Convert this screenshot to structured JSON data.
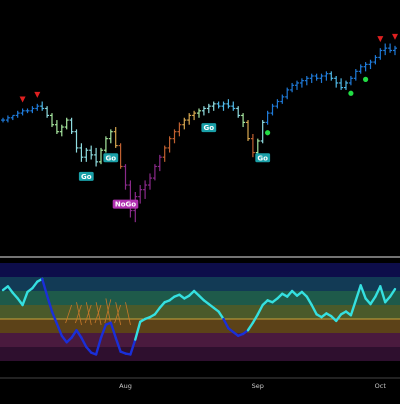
{
  "colors": {
    "background": "#000000",
    "divider": "#b8b8b8",
    "axis_text": "#c8c8c8",
    "bands": [
      "#0d0d4a",
      "#123a55",
      "#1e5a4a",
      "#4a5a2a",
      "#5c4218",
      "#4a1a3e",
      "#2e0f2e"
    ],
    "zero_line": "#c9a23c",
    "osc_up": "#35e0e0",
    "osc_down": "#1a2fd8",
    "fan": "#c7782a",
    "dot": "#22dd44",
    "triangle": "#e02020",
    "label_go_bg": "#1aa0a8",
    "label_nogo_bg": "#b030b0",
    "label_text": "#ffffff"
  },
  "chart_data": [
    {
      "type": "ohlc",
      "trend_colors": {
        "strong_go": "#1f7ad8",
        "go": "#4fb8e6",
        "weak_go": "#8fdce0",
        "neutral": "#a8e8a0",
        "weak_nogo": "#d8a850",
        "nogo": "#c06030",
        "strong_nogo": "#8a2a8a"
      },
      "ylim": [
        0,
        100
      ],
      "bars": [
        {
          "o": 56,
          "h": 57,
          "l": 55,
          "c": 56,
          "s": "strong_go"
        },
        {
          "o": 56,
          "h": 58,
          "l": 55,
          "c": 57,
          "s": "strong_go"
        },
        {
          "o": 57,
          "h": 58,
          "l": 56,
          "c": 58,
          "s": "strong_go"
        },
        {
          "o": 58,
          "h": 60,
          "l": 57,
          "c": 59,
          "s": "strong_go"
        },
        {
          "o": 59,
          "h": 61,
          "l": 58,
          "c": 60,
          "s": "strong_go"
        },
        {
          "o": 60,
          "h": 61,
          "l": 59,
          "c": 60,
          "s": "strong_go"
        },
        {
          "o": 60,
          "h": 62,
          "l": 59,
          "c": 61,
          "s": "strong_go"
        },
        {
          "o": 61,
          "h": 63,
          "l": 60,
          "c": 62,
          "s": "strong_go"
        },
        {
          "o": 62,
          "h": 64,
          "l": 60,
          "c": 61,
          "s": "go"
        },
        {
          "o": 61,
          "h": 62,
          "l": 57,
          "c": 58,
          "s": "weak_go"
        },
        {
          "o": 58,
          "h": 59,
          "l": 53,
          "c": 54,
          "s": "neutral"
        },
        {
          "o": 54,
          "h": 56,
          "l": 50,
          "c": 51,
          "s": "neutral"
        },
        {
          "o": 51,
          "h": 54,
          "l": 49,
          "c": 53,
          "s": "neutral"
        },
        {
          "o": 53,
          "h": 57,
          "l": 52,
          "c": 56,
          "s": "neutral"
        },
        {
          "o": 56,
          "h": 57,
          "l": 50,
          "c": 51,
          "s": "weak_go"
        },
        {
          "o": 51,
          "h": 52,
          "l": 42,
          "c": 44,
          "s": "weak_go"
        },
        {
          "o": 44,
          "h": 46,
          "l": 38,
          "c": 40,
          "s": "weak_go"
        },
        {
          "o": 40,
          "h": 44,
          "l": 38,
          "c": 43,
          "s": "weak_go"
        },
        {
          "o": 43,
          "h": 45,
          "l": 39,
          "c": 41,
          "s": "weak_go"
        },
        {
          "o": 41,
          "h": 44,
          "l": 36,
          "c": 38,
          "s": "weak_go"
        },
        {
          "o": 38,
          "h": 44,
          "l": 37,
          "c": 43,
          "s": "neutral"
        },
        {
          "o": 43,
          "h": 49,
          "l": 42,
          "c": 48,
          "s": "neutral"
        },
        {
          "o": 48,
          "h": 52,
          "l": 46,
          "c": 51,
          "s": "neutral"
        },
        {
          "o": 51,
          "h": 53,
          "l": 44,
          "c": 45,
          "s": "weak_nogo"
        },
        {
          "o": 45,
          "h": 46,
          "l": 35,
          "c": 36,
          "s": "nogo"
        },
        {
          "o": 36,
          "h": 37,
          "l": 26,
          "c": 28,
          "s": "strong_nogo"
        },
        {
          "o": 28,
          "h": 30,
          "l": 14,
          "c": 17,
          "s": "strong_nogo"
        },
        {
          "o": 17,
          "h": 25,
          "l": 12,
          "c": 23,
          "s": "strong_nogo"
        },
        {
          "o": 23,
          "h": 28,
          "l": 20,
          "c": 26,
          "s": "strong_nogo"
        },
        {
          "o": 26,
          "h": 30,
          "l": 22,
          "c": 28,
          "s": "strong_nogo"
        },
        {
          "o": 28,
          "h": 33,
          "l": 26,
          "c": 31,
          "s": "strong_nogo"
        },
        {
          "o": 31,
          "h": 37,
          "l": 30,
          "c": 36,
          "s": "strong_nogo"
        },
        {
          "o": 36,
          "h": 41,
          "l": 34,
          "c": 40,
          "s": "strong_nogo"
        },
        {
          "o": 40,
          "h": 45,
          "l": 38,
          "c": 44,
          "s": "nogo"
        },
        {
          "o": 44,
          "h": 49,
          "l": 42,
          "c": 48,
          "s": "nogo"
        },
        {
          "o": 48,
          "h": 52,
          "l": 46,
          "c": 51,
          "s": "nogo"
        },
        {
          "o": 51,
          "h": 55,
          "l": 49,
          "c": 54,
          "s": "nogo"
        },
        {
          "o": 54,
          "h": 57,
          "l": 52,
          "c": 56,
          "s": "weak_nogo"
        },
        {
          "o": 56,
          "h": 59,
          "l": 54,
          "c": 58,
          "s": "weak_nogo"
        },
        {
          "o": 58,
          "h": 60,
          "l": 56,
          "c": 59,
          "s": "weak_nogo"
        },
        {
          "o": 59,
          "h": 61,
          "l": 57,
          "c": 60,
          "s": "neutral"
        },
        {
          "o": 60,
          "h": 62,
          "l": 58,
          "c": 61,
          "s": "weak_go"
        },
        {
          "o": 61,
          "h": 63,
          "l": 59,
          "c": 62,
          "s": "weak_go"
        },
        {
          "o": 62,
          "h": 64,
          "l": 60,
          "c": 63,
          "s": "weak_go"
        },
        {
          "o": 63,
          "h": 64,
          "l": 61,
          "c": 62,
          "s": "go"
        },
        {
          "o": 62,
          "h": 64,
          "l": 60,
          "c": 63,
          "s": "go"
        },
        {
          "o": 63,
          "h": 65,
          "l": 61,
          "c": 62,
          "s": "go"
        },
        {
          "o": 62,
          "h": 64,
          "l": 60,
          "c": 61,
          "s": "go"
        },
        {
          "o": 61,
          "h": 62,
          "l": 57,
          "c": 58,
          "s": "weak_go"
        },
        {
          "o": 58,
          "h": 59,
          "l": 53,
          "c": 55,
          "s": "neutral"
        },
        {
          "o": 55,
          "h": 56,
          "l": 47,
          "c": 48,
          "s": "weak_nogo"
        },
        {
          "o": 48,
          "h": 50,
          "l": 40,
          "c": 42,
          "s": "nogo"
        },
        {
          "o": 42,
          "h": 48,
          "l": 40,
          "c": 47,
          "s": "neutral"
        },
        {
          "o": 47,
          "h": 56,
          "l": 46,
          "c": 55,
          "s": "weak_go"
        },
        {
          "o": 55,
          "h": 60,
          "l": 54,
          "c": 59,
          "s": "strong_go"
        },
        {
          "o": 59,
          "h": 63,
          "l": 58,
          "c": 62,
          "s": "strong_go"
        },
        {
          "o": 62,
          "h": 65,
          "l": 61,
          "c": 64,
          "s": "strong_go"
        },
        {
          "o": 64,
          "h": 67,
          "l": 63,
          "c": 66,
          "s": "strong_go"
        },
        {
          "o": 66,
          "h": 70,
          "l": 65,
          "c": 69,
          "s": "strong_go"
        },
        {
          "o": 69,
          "h": 72,
          "l": 68,
          "c": 71,
          "s": "strong_go"
        },
        {
          "o": 71,
          "h": 73,
          "l": 69,
          "c": 72,
          "s": "strong_go"
        },
        {
          "o": 72,
          "h": 74,
          "l": 70,
          "c": 73,
          "s": "strong_go"
        },
        {
          "o": 73,
          "h": 75,
          "l": 71,
          "c": 74,
          "s": "strong_go"
        },
        {
          "o": 74,
          "h": 76,
          "l": 72,
          "c": 75,
          "s": "strong_go"
        },
        {
          "o": 75,
          "h": 76,
          "l": 73,
          "c": 74,
          "s": "strong_go"
        },
        {
          "o": 74,
          "h": 76,
          "l": 72,
          "c": 75,
          "s": "strong_go"
        },
        {
          "o": 75,
          "h": 77,
          "l": 73,
          "c": 76,
          "s": "strong_go"
        },
        {
          "o": 76,
          "h": 77,
          "l": 73,
          "c": 74,
          "s": "go"
        },
        {
          "o": 74,
          "h": 75,
          "l": 70,
          "c": 72,
          "s": "go"
        },
        {
          "o": 72,
          "h": 74,
          "l": 69,
          "c": 70,
          "s": "go"
        },
        {
          "o": 70,
          "h": 73,
          "l": 69,
          "c": 72,
          "s": "go"
        },
        {
          "o": 72,
          "h": 75,
          "l": 71,
          "c": 74,
          "s": "strong_go"
        },
        {
          "o": 74,
          "h": 78,
          "l": 73,
          "c": 77,
          "s": "strong_go"
        },
        {
          "o": 77,
          "h": 80,
          "l": 76,
          "c": 79,
          "s": "strong_go"
        },
        {
          "o": 79,
          "h": 81,
          "l": 77,
          "c": 80,
          "s": "strong_go"
        },
        {
          "o": 80,
          "h": 82,
          "l": 78,
          "c": 81,
          "s": "strong_go"
        },
        {
          "o": 81,
          "h": 84,
          "l": 80,
          "c": 83,
          "s": "strong_go"
        },
        {
          "o": 83,
          "h": 87,
          "l": 82,
          "c": 86,
          "s": "strong_go"
        },
        {
          "o": 86,
          "h": 89,
          "l": 84,
          "c": 87,
          "s": "strong_go"
        },
        {
          "o": 87,
          "h": 89,
          "l": 85,
          "c": 86,
          "s": "strong_go"
        },
        {
          "o": 86,
          "h": 88,
          "l": 84,
          "c": 87,
          "s": "strong_go"
        }
      ],
      "go_labels": [
        {
          "bar": 17,
          "text": "Go",
          "kind": "go"
        },
        {
          "bar": 22,
          "text": "Go",
          "kind": "go"
        },
        {
          "bar": 25,
          "text": "NoGo",
          "kind": "nogo"
        },
        {
          "bar": 42,
          "text": "Go",
          "kind": "go"
        },
        {
          "bar": 53,
          "text": "Go",
          "kind": "go"
        }
      ],
      "triangles": [
        4,
        7,
        77,
        80
      ],
      "dots": [
        54,
        71,
        74
      ]
    },
    {
      "type": "oscillator",
      "ylim": [
        -6,
        6
      ],
      "bands": [
        4.5,
        3,
        1.5,
        0,
        -1.5,
        -3,
        -4.5
      ],
      "x_labels": [
        {
          "bar": 25,
          "text": "Aug"
        },
        {
          "bar": 52,
          "text": "Sep"
        },
        {
          "bar": 77,
          "text": "Oct"
        }
      ],
      "values": [
        3.1,
        3.5,
        2.8,
        2.2,
        1.5,
        2.9,
        3.3,
        4.0,
        4.3,
        2.5,
        0.8,
        -0.5,
        -1.8,
        -2.5,
        -2.0,
        -1.2,
        -2.0,
        -3.0,
        -3.6,
        -3.8,
        -2.0,
        -0.6,
        -0.4,
        -2.0,
        -3.5,
        -3.7,
        -3.8,
        -2.2,
        -0.3,
        0,
        0.2,
        0.5,
        1.2,
        1.8,
        2.0,
        2.4,
        2.6,
        2.2,
        2.5,
        3.0,
        2.5,
        2.0,
        1.6,
        1.2,
        0.8,
        0,
        -1.0,
        -1.4,
        -1.8,
        -1.6,
        -1.2,
        -0.4,
        0.5,
        1.5,
        2.0,
        1.8,
        2.2,
        2.7,
        2.4,
        3.0,
        2.5,
        2.9,
        2.4,
        1.5,
        0.5,
        0.2,
        0.6,
        0.3,
        -0.2,
        0.5,
        0.8,
        0.4,
        2.0,
        3.6,
        2.2,
        1.6,
        2.4,
        3.5,
        1.8,
        2.4,
        3.2
      ],
      "up_segments": [
        [
          0,
          8
        ],
        [
          27,
          45
        ],
        [
          50,
          80
        ]
      ],
      "fan_range": [
        14,
        25
      ]
    }
  ]
}
